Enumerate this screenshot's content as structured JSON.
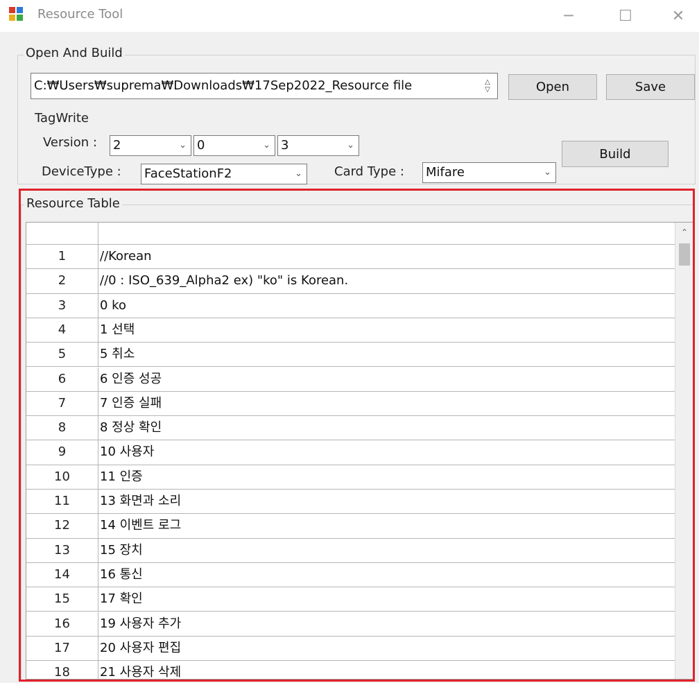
{
  "window": {
    "title": "Resource Tool",
    "minimize_glyph": "─",
    "maximize_glyph": "☐",
    "close_glyph": "✕"
  },
  "open_build": {
    "group_label": "Open And Build",
    "path_value": "C:₩Users₩suprema₩Downloads₩17Sep2022_Resource file",
    "open_label": "Open",
    "save_label": "Save",
    "tagwrite_label": "TagWrite",
    "version_label": "Version :",
    "version_values": [
      "2",
      "0",
      "3"
    ],
    "device_type_label": "DeviceType :",
    "device_type_value": "FaceStationF2",
    "card_type_label": "Card Type :",
    "card_type_value": "Mifare",
    "build_label": "Build"
  },
  "resource_table": {
    "group_label": "Resource Table",
    "rows": [
      {
        "num": "1",
        "text": "//Korean"
      },
      {
        "num": "2",
        "text": "//0 : ISO_639_Alpha2 ex) \"ko\" is Korean."
      },
      {
        "num": "3",
        "text": "0 ko"
      },
      {
        "num": "4",
        "text": "1 선택"
      },
      {
        "num": "5",
        "text": "5 취소"
      },
      {
        "num": "6",
        "text": "6 인증 성공"
      },
      {
        "num": "7",
        "text": "7 인증 실패"
      },
      {
        "num": "8",
        "text": "8 정상 확인"
      },
      {
        "num": "9",
        "text": "10 사용자"
      },
      {
        "num": "10",
        "text": "11 인증"
      },
      {
        "num": "11",
        "text": "13 화면과 소리"
      },
      {
        "num": "12",
        "text": "14 이벤트 로그"
      },
      {
        "num": "13",
        "text": "15 장치"
      },
      {
        "num": "14",
        "text": "16 통신"
      },
      {
        "num": "15",
        "text": "17 확인"
      },
      {
        "num": "16",
        "text": "19 사용자 추가"
      },
      {
        "num": "17",
        "text": "20 사용자 편집"
      },
      {
        "num": "18",
        "text": "21 사용자 삭제"
      }
    ]
  },
  "colors": {
    "highlight_frame": "#e0212b"
  }
}
